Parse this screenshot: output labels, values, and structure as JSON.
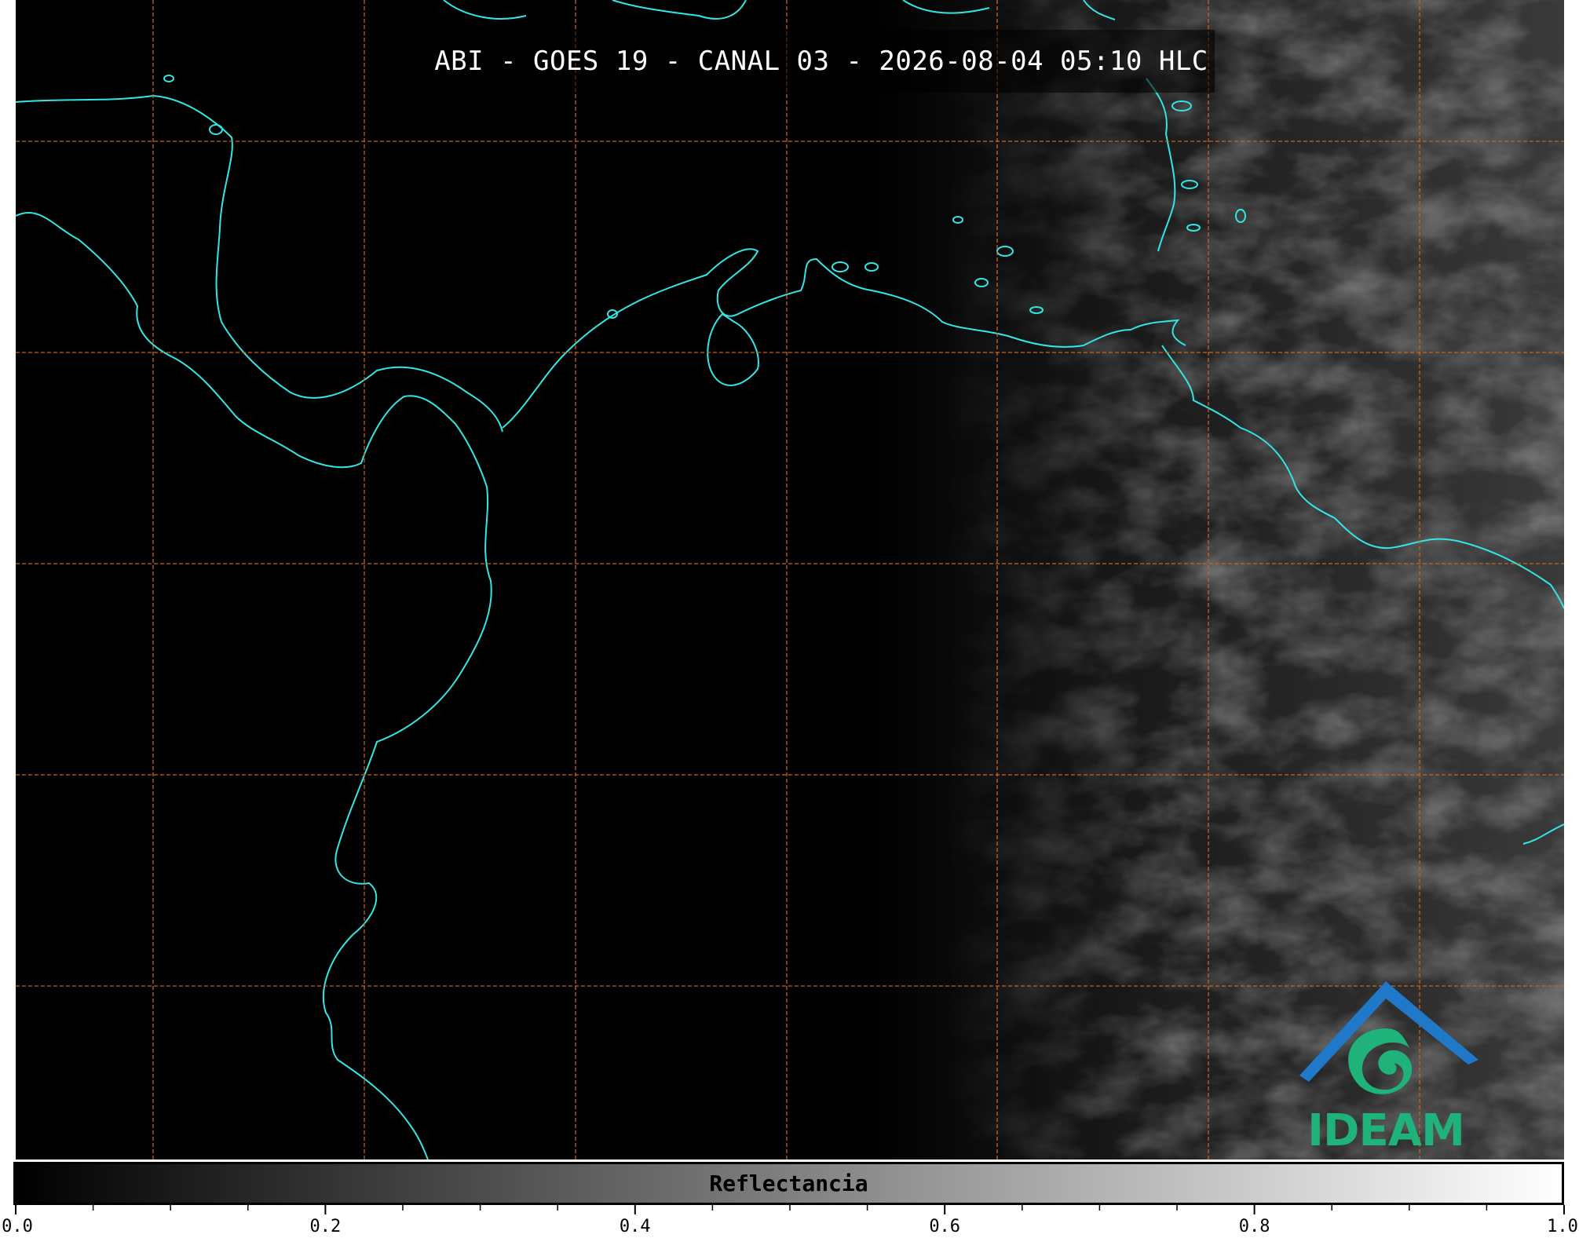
{
  "title": "ABI - GOES 19 - CANAL 03 - 2026-08-04 05:10 HLC",
  "colors": {
    "coastline": "#33e6e6",
    "gridline": "#c8641e",
    "background": "#000000",
    "logo_green": "#1fb27a",
    "logo_blue": "#1f78c8"
  },
  "logo": {
    "icon": "ideam-logo-icon",
    "text": "IDEAM"
  },
  "colorbar": {
    "label": "Reflectancia",
    "min": 0.0,
    "max": 1.0,
    "tick_labels": [
      "0.0",
      "0.2",
      "0.4",
      "0.6",
      "0.8",
      "1.0"
    ],
    "tick_values": [
      0.0,
      0.2,
      0.4,
      0.6,
      0.8,
      1.0
    ],
    "minor_ticks": 20
  },
  "gridlines": {
    "style": "dashed",
    "vertical_count": 7,
    "horizontal_count": 5
  }
}
